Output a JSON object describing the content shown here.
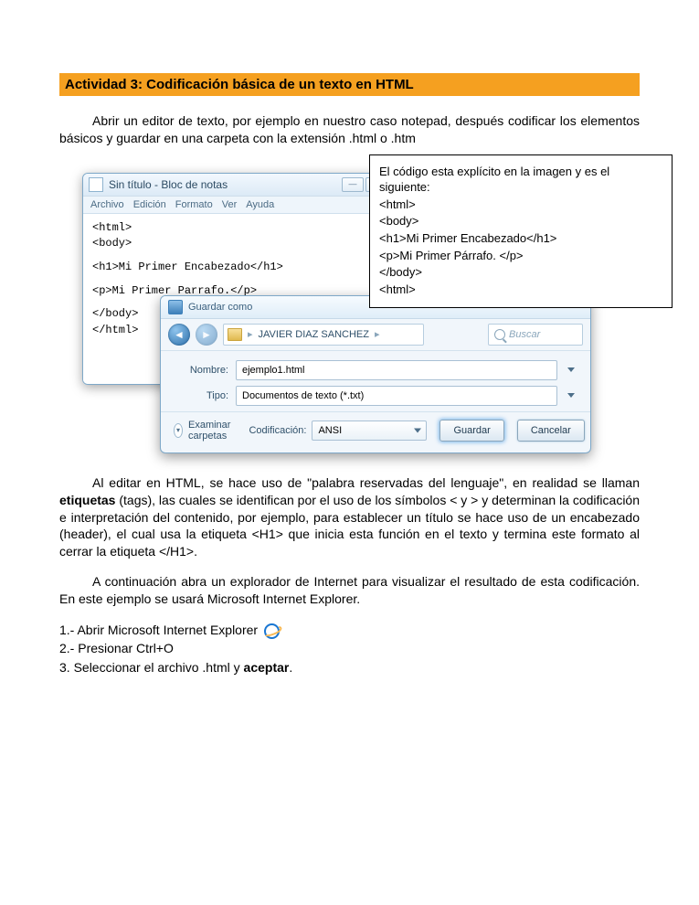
{
  "header": "Actividad 3: Codificación básica de un texto en HTML",
  "intro": "Abrir un editor de texto, por ejemplo en nuestro caso notepad, después codificar los elementos básicos y guardar en una carpeta con la extensión .html o .htm",
  "notepad": {
    "title": "Sin título - Bloc de notas",
    "menu": [
      "Archivo",
      "Edición",
      "Formato",
      "Ver",
      "Ayuda"
    ],
    "lines": [
      "<html>",
      "<body>",
      "",
      "<h1>Mi Primer Encabezado</h1>",
      "",
      "<p>Mi Primer Parrafo.</p>",
      "",
      "</body>",
      "</html>"
    ]
  },
  "saveas": {
    "title": "Guardar como",
    "crumb_user": "JAVIER DIAZ SANCHEZ",
    "search_placeholder": "Buscar",
    "name_label": "Nombre:",
    "name_value": "ejemplo1.html",
    "type_label": "Tipo:",
    "type_value": "Documentos de texto (*.txt)",
    "examine": "Examinar carpetas",
    "encoding_label": "Codificación:",
    "encoding_value": "ANSI",
    "save_btn": "Guardar",
    "cancel_btn": "Cancelar"
  },
  "callout": {
    "l0": "El código esta explícito en la imagen y es el siguiente:",
    "l1": "<html>",
    "l2": "<body>",
    "l3": "<h1>Mi Primer Encabezado</h1>",
    "l4": "<p>Mi Primer Párrafo. </p>",
    "l5": "</body>",
    "l6": "<html>"
  },
  "body2a": "Al editar en HTML, se hace uso de \"palabra reservadas del lenguaje\", en realidad se llaman ",
  "body2b": "etiquetas",
  "body2c": " (tags), las cuales se identifican por el uso de los símbolos < y > y determinan la codificación e interpretación del contenido, por ejemplo, para establecer un título se hace uso de un encabezado (header), el cual usa la etiqueta <H1> que inicia esta función en el texto y termina este formato al cerrar la etiqueta </H1>.",
  "body3": "A continuación abra un explorador de Internet para visualizar el resultado de esta codificación. En este ejemplo se usará Microsoft Internet Explorer.",
  "steps": {
    "s1": "1.- Abrir Microsoft Internet Explorer ",
    "s2": "2.- Presionar Ctrl+O",
    "s3a": "3. Seleccionar el archivo .html y ",
    "s3b": "aceptar",
    "s3c": "."
  }
}
